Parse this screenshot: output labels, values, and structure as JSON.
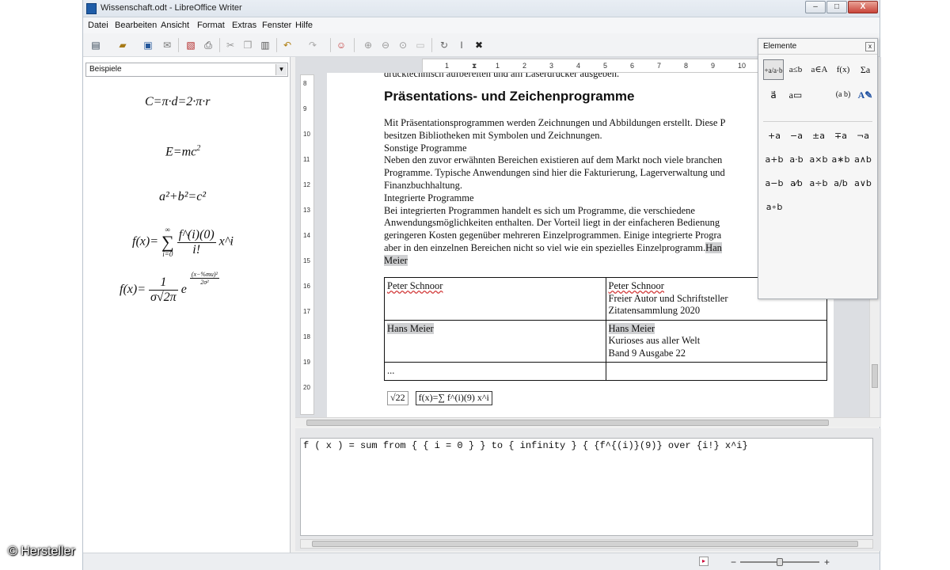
{
  "window": {
    "title": "Wissenschaft.odt - LibreOffice Writer",
    "buttons": {
      "minimize": "–",
      "maximize": "□",
      "close": "X"
    }
  },
  "menu": [
    "Datei",
    "Bearbeiten",
    "Ansicht",
    "Format",
    "Extras",
    "Fenster",
    "Hilfe"
  ],
  "toolbar": {
    "icons": [
      "new-document-icon",
      "open-icon",
      "save-icon",
      "email-icon",
      "export-pdf-icon",
      "print-icon",
      "cut-icon",
      "copy-icon",
      "paste-icon",
      "undo-icon",
      "redo-icon",
      "formula-icon",
      "zoom-in-icon",
      "zoom-out-icon",
      "zoom-100-icon",
      "show-all-icon",
      "update-icon",
      "formula-cursor-icon",
      "symbols-icon"
    ]
  },
  "left_panel": {
    "selected": "Beispiele",
    "formulas": {
      "f1": "C=π·d=2·π·r",
      "f2_base": "E=mc",
      "f2_exp": "2",
      "f3": "a²+b²=c²",
      "f4_lhs": "f(x)=",
      "f4_sum_top": "∞",
      "f4_sum_bot": "i=0",
      "f4_num": "f^(i)(0)",
      "f4_den": "i!",
      "f4_tail": "x^i",
      "f5_lhs": "f(x)=",
      "f5_num": "1",
      "f5_den": "σ√2π",
      "f5_e": "e",
      "f5_exp_num": "(x−%mu)²",
      "f5_exp_den": "2σ²"
    }
  },
  "ruler": {
    "h_labels": [
      "1",
      "1",
      "2",
      "3",
      "4",
      "5",
      "6",
      "7",
      "8",
      "9",
      "10"
    ],
    "v_labels": [
      "8",
      "9",
      "10",
      "11",
      "12",
      "13",
      "14",
      "15",
      "16",
      "17",
      "18",
      "19",
      "20"
    ]
  },
  "document": {
    "cut_line": "drucktechnisch aufbereiten und am Laserdrucker ausgeben.",
    "heading": "Präsentations- und Zeichenprogramme",
    "lines": [
      "Mit Präsentationsprogrammen werden Zeichnungen und Abbildungen erstellt. Diese P",
      "besitzen Bibliotheken mit Symbolen und Zeichnungen.",
      "Sonstige Programme",
      "Neben den zuvor erwähnten Bereichen existieren auf dem Markt noch viele branchen",
      "Programme. Typische Anwendungen sind hier die Fakturierung, Lagerverwaltung und",
      "Finanzbuchhaltung.",
      "Integrierte Programme",
      "Bei integrierten Programmen  handelt es sich um Programme, die verschiedene",
      "Anwendungsmöglichkeiten enthalten. Der Vorteil liegt in der einfacheren Bedienung",
      "geringeren Kosten gegenüber mehreren Einzelprogrammen. Einige integrierte Progra",
      "aber in den einzelnen Bereichen nicht so viel wie ein spezielles Einzelprogramm.",
      "Meier"
    ],
    "line11_highlight": "Han",
    "table": [
      [
        "Peter Schnoor",
        [
          "Peter Schnoor",
          "Freier Autor und Schriftsteller",
          "Zitatensammlung 2020"
        ]
      ],
      [
        "Hans Meier",
        [
          "Hans Meier",
          "Kurioses aus aller Welt",
          "Band 9 Ausgabe 22"
        ]
      ],
      [
        "...",
        [
          ""
        ]
      ]
    ],
    "inline_sqrt": "√22",
    "inline_formula": "f(x)=∑ f^(i)(9) x^i"
  },
  "elements_panel": {
    "title": "Elemente",
    "close": "x",
    "categories": [
      "+a/a·b",
      "a≤b",
      "a∈A",
      "f(x)",
      "Σa",
      "a⃗",
      "a▭",
      "(a b)",
      "A✎"
    ],
    "symbols": [
      "+a",
      "−a",
      "±a",
      "∓a",
      "¬a",
      "a+b",
      "a·b",
      "a×b",
      "a∗b",
      "a∧b",
      "a−b",
      "a/b frac",
      "a÷b",
      "a/b",
      "a∨b",
      "a∘b"
    ],
    "symbol_labels": [
      "+a",
      "−a",
      "±a",
      "∓a",
      "¬a",
      "a+b",
      "a·b",
      "a×b",
      "a∗b",
      "a∧b",
      "a−b",
      "a⁄b",
      "a÷b",
      "a/b",
      "a∨b",
      "a∘b"
    ]
  },
  "command": {
    "text": "f ( x ) = sum from { { i = 0 } } to { infinity } { {f^{(i)}(9)} over {i!} x^i}"
  },
  "credit": "© Hersteller"
}
